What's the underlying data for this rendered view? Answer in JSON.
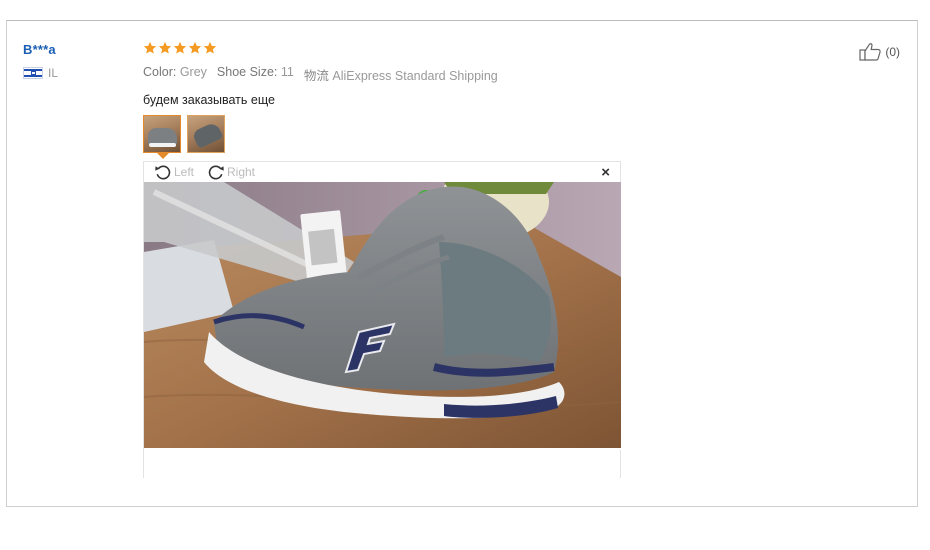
{
  "review": {
    "author": {
      "name": "B***a",
      "country_code": "IL",
      "flag_icon": "israel-flag-icon"
    },
    "rating": 5,
    "attributes": [
      {
        "label": "Color:",
        "value": "Grey"
      },
      {
        "label": "Shoe Size:",
        "value": "11"
      },
      {
        "label": "物流",
        "value": "AliExpress Standard Shipping"
      }
    ],
    "text": "будем заказывать еще",
    "photos_count": 2,
    "viewer": {
      "rotate_left_label": "Left",
      "rotate_right_label": "Right",
      "close_glyph": "×"
    },
    "helpful": {
      "count_label": "(0)",
      "icon": "thumbs-up-icon"
    }
  },
  "colors": {
    "star": "#f59a23",
    "author_link": "#1a5fb4",
    "thumb_border": "#e38b2a"
  }
}
